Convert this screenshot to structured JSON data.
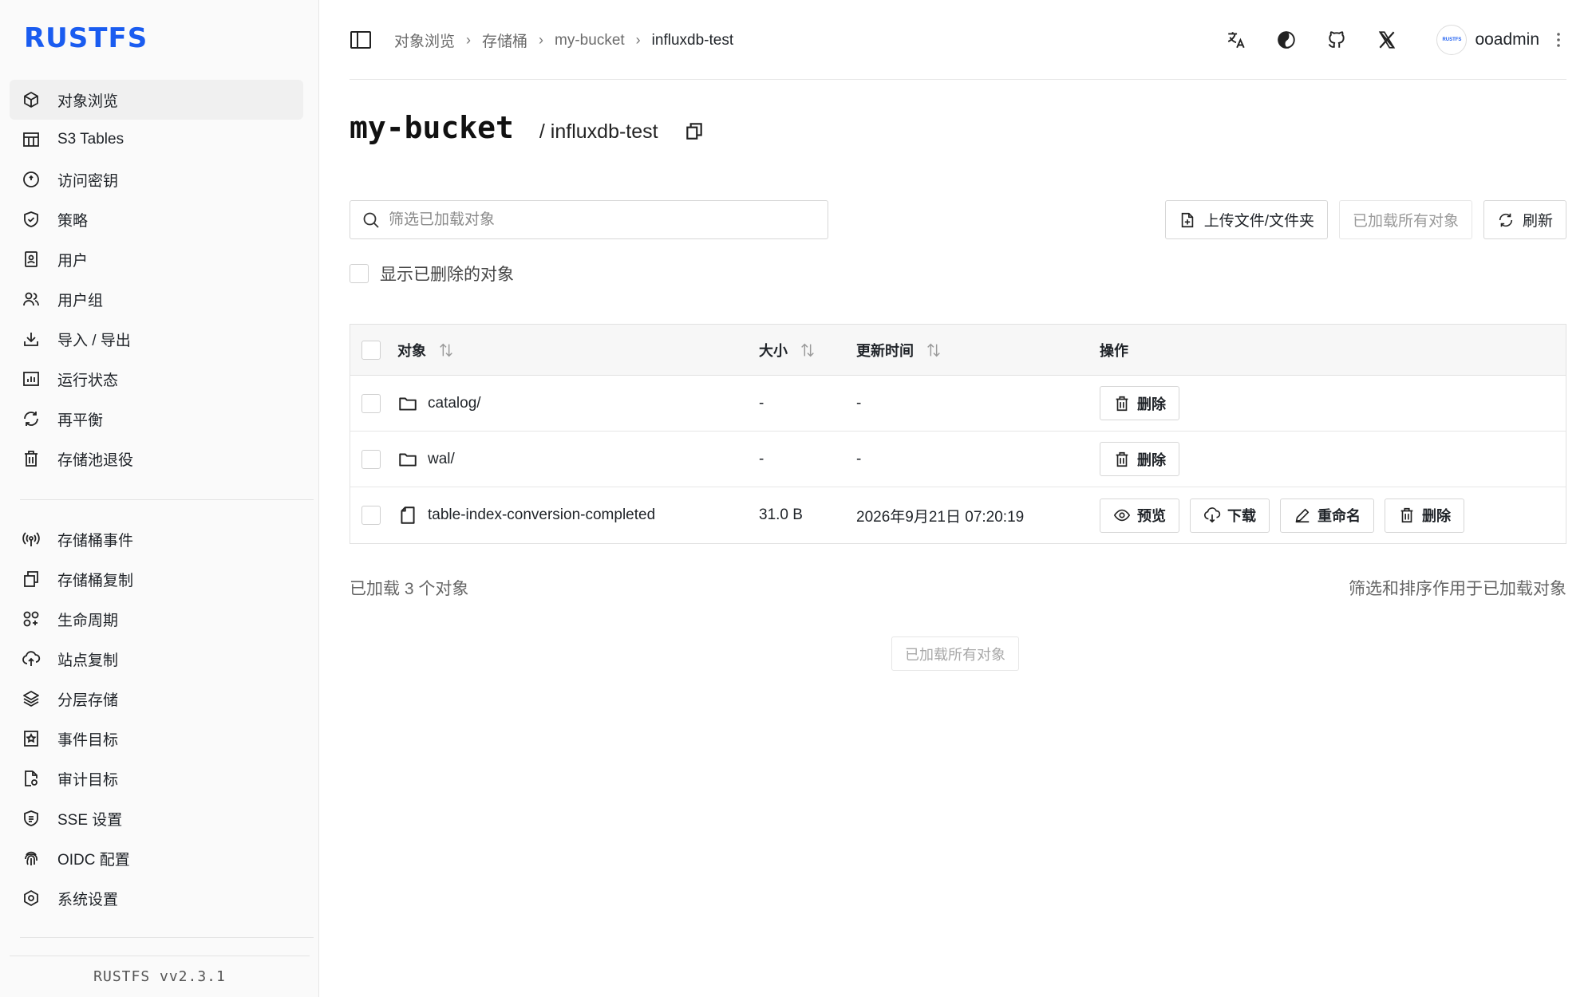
{
  "brand": "RUSTFS",
  "sidebar": {
    "items": [
      {
        "label": "对象浏览",
        "icon": "cube-icon",
        "active": true
      },
      {
        "label": "S3 Tables",
        "icon": "table-icon"
      },
      {
        "label": "访问密钥",
        "icon": "key-icon"
      },
      {
        "label": "策略",
        "icon": "shield-check-icon"
      },
      {
        "label": "用户",
        "icon": "user-card-icon"
      },
      {
        "label": "用户组",
        "icon": "users-icon"
      },
      {
        "label": "导入 / 导出",
        "icon": "download-icon"
      },
      {
        "label": "运行状态",
        "icon": "bar-chart-icon"
      },
      {
        "label": "再平衡",
        "icon": "refresh-icon"
      },
      {
        "label": "存储池退役",
        "icon": "trash-icon"
      }
    ],
    "items2": [
      {
        "label": "存储桶事件",
        "icon": "broadcast-icon"
      },
      {
        "label": "存储桶复制",
        "icon": "copy-icon"
      },
      {
        "label": "生命周期",
        "icon": "lifecycle-icon"
      },
      {
        "label": "站点复制",
        "icon": "cloud-upload-icon"
      },
      {
        "label": "分层存储",
        "icon": "layers-icon"
      },
      {
        "label": "事件目标",
        "icon": "bookmark-star-icon"
      },
      {
        "label": "审计目标",
        "icon": "file-audit-icon"
      },
      {
        "label": "SSE 设置",
        "icon": "encryption-icon"
      },
      {
        "label": "OIDC 配置",
        "icon": "fingerprint-icon"
      },
      {
        "label": "系统设置",
        "icon": "hexagon-settings-icon"
      }
    ],
    "footer": "RUSTFS vv2.3.1"
  },
  "breadcrumb": {
    "items": [
      "对象浏览",
      "存储桶",
      "my-bucket"
    ],
    "current": "influxdb-test"
  },
  "user": {
    "name": "ooadmin",
    "avatar_text": "RUSTFS"
  },
  "header": {
    "bucket": "my-bucket",
    "prefix": "/ influxdb-test"
  },
  "search": {
    "placeholder": "筛选已加载对象"
  },
  "actions": {
    "upload": "上传文件/文件夹",
    "loaded_all": "已加载所有对象",
    "refresh": "刷新"
  },
  "show_deleted": "显示已删除的对象",
  "table": {
    "headers": {
      "name": "对象",
      "size": "大小",
      "updated": "更新时间",
      "actions": "操作"
    },
    "rows": [
      {
        "name": "catalog/",
        "type": "folder",
        "size": "-",
        "updated": "-",
        "actions": [
          "删除"
        ]
      },
      {
        "name": "wal/",
        "type": "folder",
        "size": "-",
        "updated": "-",
        "actions": [
          "删除"
        ]
      },
      {
        "name": "table-index-conversion-completed",
        "type": "file",
        "size": "31.0 B",
        "updated": "2026年9月21日 07:20:19",
        "actions": [
          "预览",
          "下载",
          "重命名",
          "删除"
        ]
      }
    ]
  },
  "footer": {
    "loaded_count": "已加载 3 个对象",
    "filter_note": "筛选和排序作用于已加载对象",
    "load_all": "已加载所有对象"
  },
  "colors": {
    "brand": "#1a5cf0"
  }
}
